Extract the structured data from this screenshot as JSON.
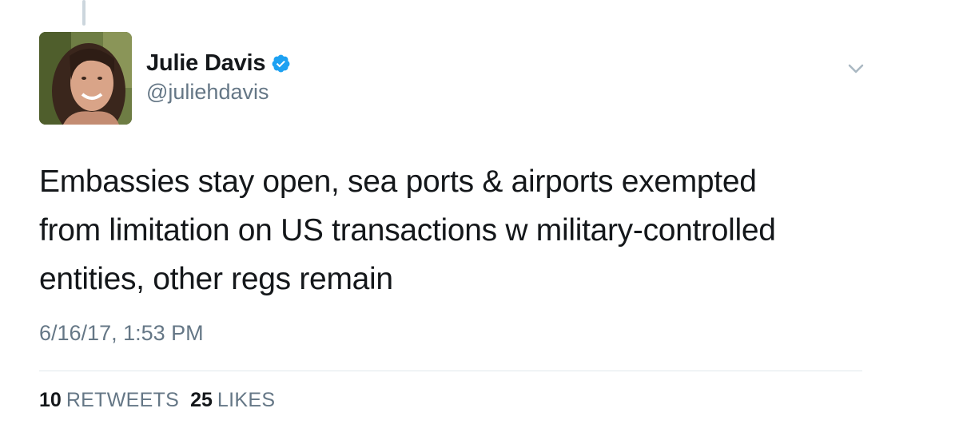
{
  "author": {
    "display_name": "Julie Davis",
    "handle": "@juliehdavis",
    "verified": true,
    "avatar_icon": "profile-photo"
  },
  "tweet": {
    "text_lines": [
      "Embassies stay open, sea ports & airports exempted",
      "from limitation on US transactions w military-controlled",
      "entities, other regs remain"
    ],
    "timestamp": "6/16/17, 1:53 PM"
  },
  "stats": {
    "retweets_count": "10",
    "retweets_label": "RETWEETS",
    "likes_count": "25",
    "likes_label": "LIKES"
  },
  "icons": {
    "verified": "verified-badge-icon",
    "menu": "chevron-down-icon"
  },
  "colors": {
    "text": "#14171a",
    "secondary": "#657786",
    "verified_blue": "#1da1f2",
    "divider": "#e1e8ed",
    "thread_line": "#ccd6dd"
  }
}
